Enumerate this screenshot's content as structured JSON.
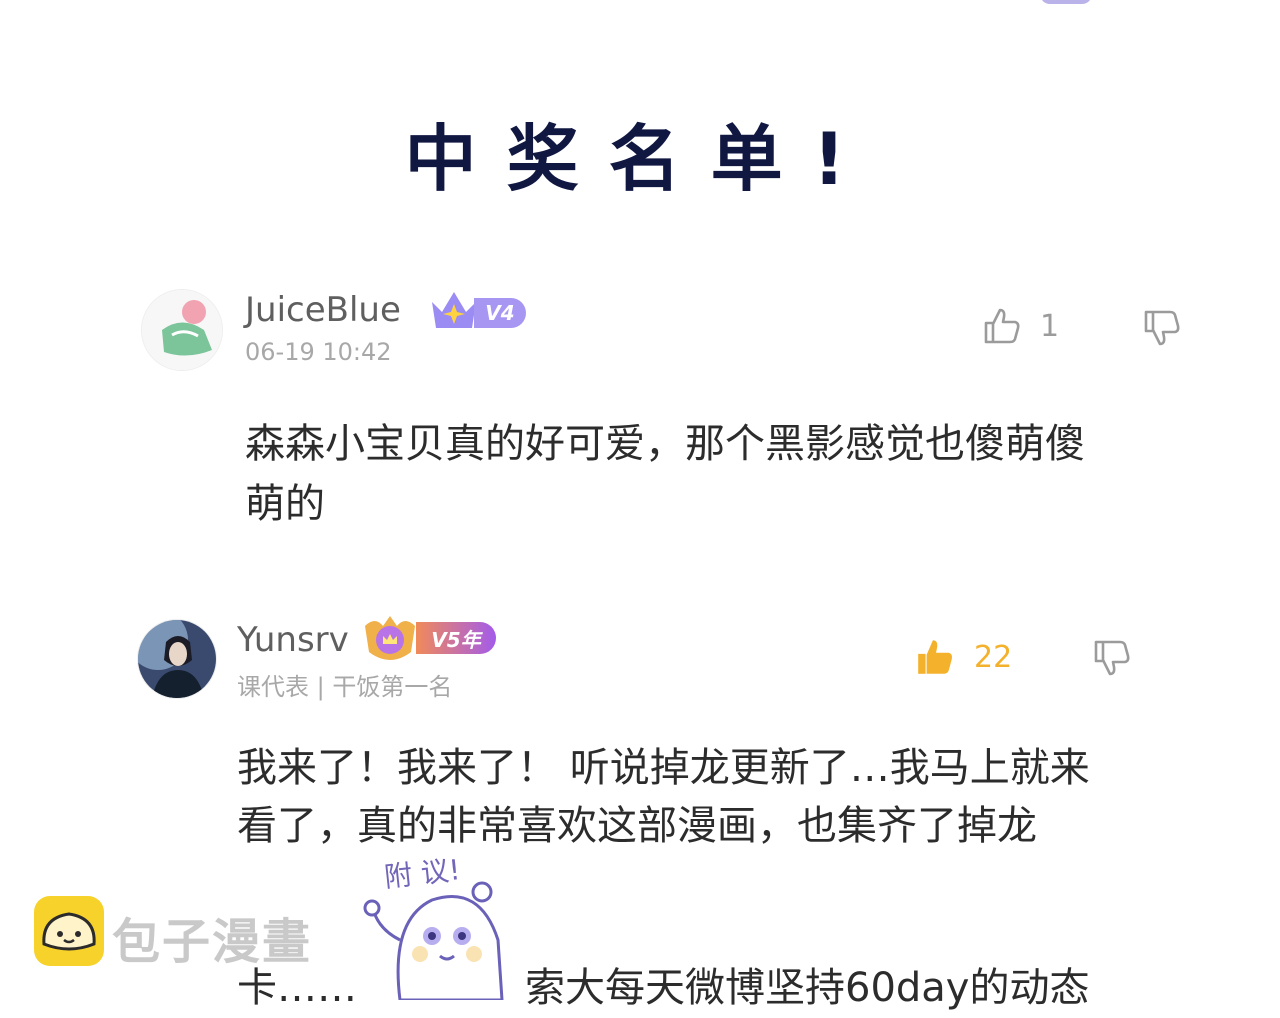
{
  "banner": {
    "title": "中奖名单!"
  },
  "comments": [
    {
      "username": "JuiceBlue",
      "vip_label": "V4",
      "timestamp": "06-19 10:42",
      "likes": "1",
      "text_lines": [
        "森森小宝贝真的好可爱，那个黑影感觉也傻萌傻",
        "萌的"
      ],
      "like_color": "#9b9b9b"
    },
    {
      "username": "Yunsrv",
      "vip_label": "V5年",
      "subtitle": "课代表 | 干饭第一名",
      "likes": "22",
      "text_lines": [
        "我来了！我来了！ 听说掉龙更新了…我马上就来",
        "看了，真的非常喜欢这部漫画，也集齐了掉龙"
      ],
      "text_tail_left": "卡……",
      "text_tail_right": "索大每天微博坚持60day的动态",
      "like_color": "#f3b12c"
    }
  ],
  "sticker": {
    "label": "附 议!"
  },
  "watermark": {
    "text": "包子漫畫"
  },
  "colors": {
    "title": "#101842",
    "vip_purple": "#8f7cf2",
    "vip_orange": "#f2a03a",
    "active_like": "#f3b12c"
  }
}
